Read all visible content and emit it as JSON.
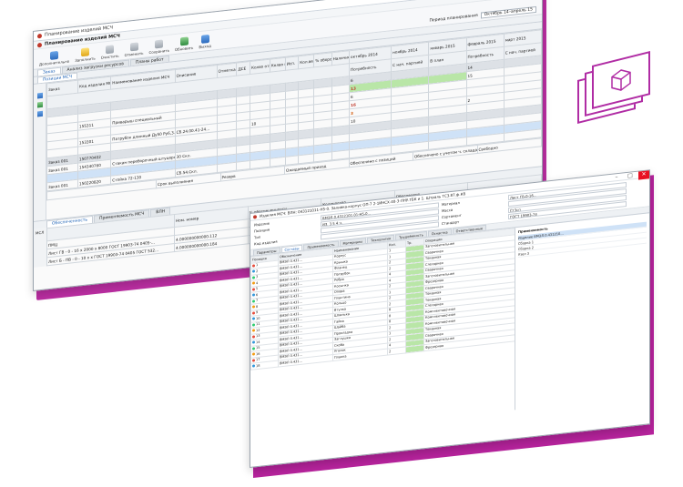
{
  "window1": {
    "title": "Планирование изделий МСЧ",
    "header": "Планирование изделий МСЧ",
    "toolbar": [
      {
        "label": "Дополнительно",
        "icon": "wrench-icon",
        "color": "blue"
      },
      {
        "label": "Заполнить",
        "icon": "lightning-icon",
        "color": "yellow"
      },
      {
        "label": "Очистить",
        "icon": "eraser-icon",
        "color": "grey"
      },
      {
        "label": "Отменить",
        "icon": "cross-icon",
        "color": "grey"
      },
      {
        "label": "Сохранить",
        "icon": "floppy-icon",
        "color": "grey"
      },
      {
        "label": "Обновить",
        "icon": "refresh-icon",
        "color": "green"
      },
      {
        "label": "Выход",
        "icon": "exit-icon",
        "color": "blue"
      }
    ],
    "period_label": "Период планирования",
    "period_value": "Октябрь 14–апрель 15",
    "tabs": [
      "Заказ",
      "Анализ загрузки ресурсов",
      "Планы работ"
    ],
    "subtab": "Позиции МСЧ",
    "columns": [
      "Заказ",
      "Код изделия МСЧ",
      "Наименование изделия МСЧ",
      "Описание",
      "Отметка окн. (ед)",
      "ДСЕ",
      "Колво отвечает (изм)",
      "Колво шт.",
      "Исп.",
      "Кол.вес. факт.",
      "% оборотные",
      "Наличие",
      "октябрь 2014",
      "ноябрь 2014",
      "январь 2015",
      "февраль 2015",
      "март 2015"
    ],
    "subheader": [
      "Потребность",
      "С нач. партией",
      "В план"
    ],
    "rows": [
      {
        "type": "group",
        "cells": [
          "",
          "",
          "",
          "",
          "",
          "",
          "",
          "",
          "",
          "",
          "",
          "",
          "6",
          "",
          "",
          "14",
          ""
        ]
      },
      {
        "type": "data",
        "cells": [
          "",
          "",
          "",
          "",
          "",
          "",
          "",
          "",
          "",
          "",
          "",
          "",
          "13",
          "",
          "",
          "15",
          ""
        ]
      },
      {
        "type": "data",
        "cells": [
          "",
          "155311",
          "Приварыш специальный",
          "",
          "",
          "",
          "",
          "",
          "",
          "",
          "",
          "",
          "6",
          "",
          "",
          "",
          ""
        ]
      },
      {
        "type": "data",
        "cells": [
          "",
          "",
          "",
          "",
          "",
          "",
          "",
          "",
          "",
          "",
          "",
          "",
          "16",
          "",
          "",
          "",
          ""
        ]
      },
      {
        "type": "data",
        "cells": [
          "",
          "153301",
          "Патрубок длинный Ду50 Ру6,3...",
          "СБ.24.00.41-24...",
          "",
          "",
          "10",
          "",
          "",
          "",
          "",
          "",
          "3",
          "",
          "",
          "2",
          ""
        ]
      },
      {
        "type": "data",
        "cells": [
          "",
          "",
          "",
          "",
          "",
          "",
          "",
          "",
          "",
          "",
          "",
          "",
          "10",
          "",
          "",
          "",
          ""
        ]
      },
      {
        "type": "group",
        "cells": [
          "Заказ 001",
          "150770402",
          "",
          "",
          "",
          "",
          "",
          "",
          "",
          "",
          "",
          "",
          "",
          "",
          "",
          "",
          ""
        ]
      },
      {
        "type": "data",
        "cells": [
          "Заказ 001",
          "154340760",
          "Стакан переборочный штуцерный",
          "30 Скл.",
          "",
          "",
          "",
          "",
          "",
          "",
          "",
          "",
          "",
          "",
          "",
          "",
          ""
        ]
      },
      {
        "type": "sel",
        "cells": [
          "",
          "",
          "",
          "",
          "",
          "",
          "",
          "",
          "",
          "",
          "",
          "",
          "",
          "",
          "",
          "",
          ""
        ]
      },
      {
        "type": "data",
        "cells": [
          "Заказ 001",
          "150220820",
          "Стойка 72-130",
          "СБ.54.Скл.",
          "",
          "",
          "",
          "",
          "",
          "",
          "",
          "",
          "",
          "",
          "",
          "",
          ""
        ]
      }
    ],
    "filter_row": [
      "Срок выполнения",
      "Резерв",
      "Ожидаемый приход",
      "Обеспечено с позиций",
      "Обеспечено с учетом ч. склада",
      "Свободно"
    ],
    "lower_tabs": [
      "Обеспеченность",
      "Применяемость МСЧ",
      "ВЛН"
    ],
    "lower_columns": [
      "Ном. номер",
      "% обеспеченности",
      "Количество",
      "Обеспечено"
    ],
    "lower_rows": [
      [
        "ПМЦ",
        "",
        "",
        "4.0000000000000000",
        "117",
        ""
      ],
      [
        "Лист ГВ - 0 - 16 х 2000 х 8000 ГОСТ 19903-74 0405-...",
        "4.000000000000.112",
        "",
        "",
        "",
        ""
      ],
      [
        "Лист Б - ПВ - 0 - 10 х х ГОСТ 19903-74 0405 ГОСТ 532...",
        "4.000000000000.184",
        "",
        "",
        "",
        ""
      ]
    ],
    "left_label": "МСЛ"
  },
  "window2": {
    "title": "Изделия МСЧ: ВЛН: 043121011-Н5-0. Заливка-корпус ОП-7 2-1ИНСХ-40-3-ЛНУ.ТБК и 1. Штраль ТС3.87.ф.К8",
    "props": [
      [
        "Изделие",
        "ВМЭЛ.0.4312101.01-Н5-0...",
        "Материал",
        "Лист ГВ-0-16..."
      ],
      [
        "Позиция",
        "ИЗ. 3 5 4 ч.",
        "Масса",
        ""
      ],
      [
        "Тип",
        "",
        "Сортамент",
        "Ст3сп"
      ],
      [
        "Код изделия",
        "",
        "Стандарт",
        "ГОСТ 19903-74"
      ]
    ],
    "tabs": [
      "Параметры",
      "Составы",
      "Применяемость",
      "Материалы",
      "Технология",
      "Трудоёмкость",
      "Оснастка",
      "Ответственные"
    ],
    "tree_columns": [
      "Позиция",
      "Обозначение",
      "Наименование",
      "Кол.",
      "Тр.",
      "Операции"
    ],
    "tree_rows": [
      [
        "1",
        "ВМЭЛ 0.431...",
        "Корпус",
        "1",
        "",
        "Заготовительная"
      ],
      [
        "2",
        "ВМЭЛ 0.431...",
        "Крышка",
        "1",
        "",
        "Сварочная"
      ],
      [
        "3",
        "ВМЭЛ 0.431...",
        "Фланец",
        "2",
        "",
        "Токарная"
      ],
      [
        "4",
        "ВМЭЛ 0.431...",
        "Патрубок",
        "2",
        "",
        "Слесарная"
      ],
      [
        "5",
        "ВМЭЛ 0.431...",
        "Ребро",
        "4",
        "",
        "Сварочная"
      ],
      [
        "6",
        "ВМЭЛ 0.431...",
        "Косынка",
        "4",
        "",
        "Заготовительная"
      ],
      [
        "7",
        "ВМЭЛ 0.431...",
        "Опора",
        "2",
        "",
        "Фрезерная"
      ],
      [
        "8",
        "ВМЭЛ 0.431...",
        "Пластина",
        "1",
        "",
        "Сварочная"
      ],
      [
        "9",
        "ВМЭЛ 0.431...",
        "Кольцо",
        "2",
        "",
        "Токарная"
      ],
      [
        "10",
        "ВМЭЛ 0.431...",
        "Втулка",
        "2",
        "",
        "Токарная"
      ],
      [
        "11",
        "ВМЭЛ 0.431...",
        "Шпилька",
        "8",
        "",
        "Слесарная"
      ],
      [
        "12",
        "ВМЭЛ 0.431...",
        "Гайка",
        "8",
        "",
        "Комплектовочная"
      ],
      [
        "13",
        "ВМЭЛ 0.431...",
        "Шайба",
        "8",
        "",
        "Комплектовочная"
      ],
      [
        "14",
        "ВМЭЛ 0.431...",
        "Прокладка",
        "2",
        "",
        "Комплектовочная"
      ],
      [
        "15",
        "ВМЭЛ 0.431...",
        "Заглушка",
        "1",
        "",
        "Токарная"
      ],
      [
        "16",
        "ВМЭЛ 0.431...",
        "Скоба",
        "2",
        "",
        "Сварочная"
      ],
      [
        "17",
        "ВМЭЛ 0.431...",
        "Уголок",
        "4",
        "",
        "Заготовительная"
      ],
      [
        "18",
        "ВМЭЛ 0.431...",
        "Планка",
        "2",
        "",
        "Фрезерная"
      ]
    ],
    "side_title": "Применяемость",
    "side_rows": [
      "Изделие ВМЭЛ.0.431210...",
      "Сборка 1",
      "Сборка 2",
      "Узел 3"
    ]
  }
}
